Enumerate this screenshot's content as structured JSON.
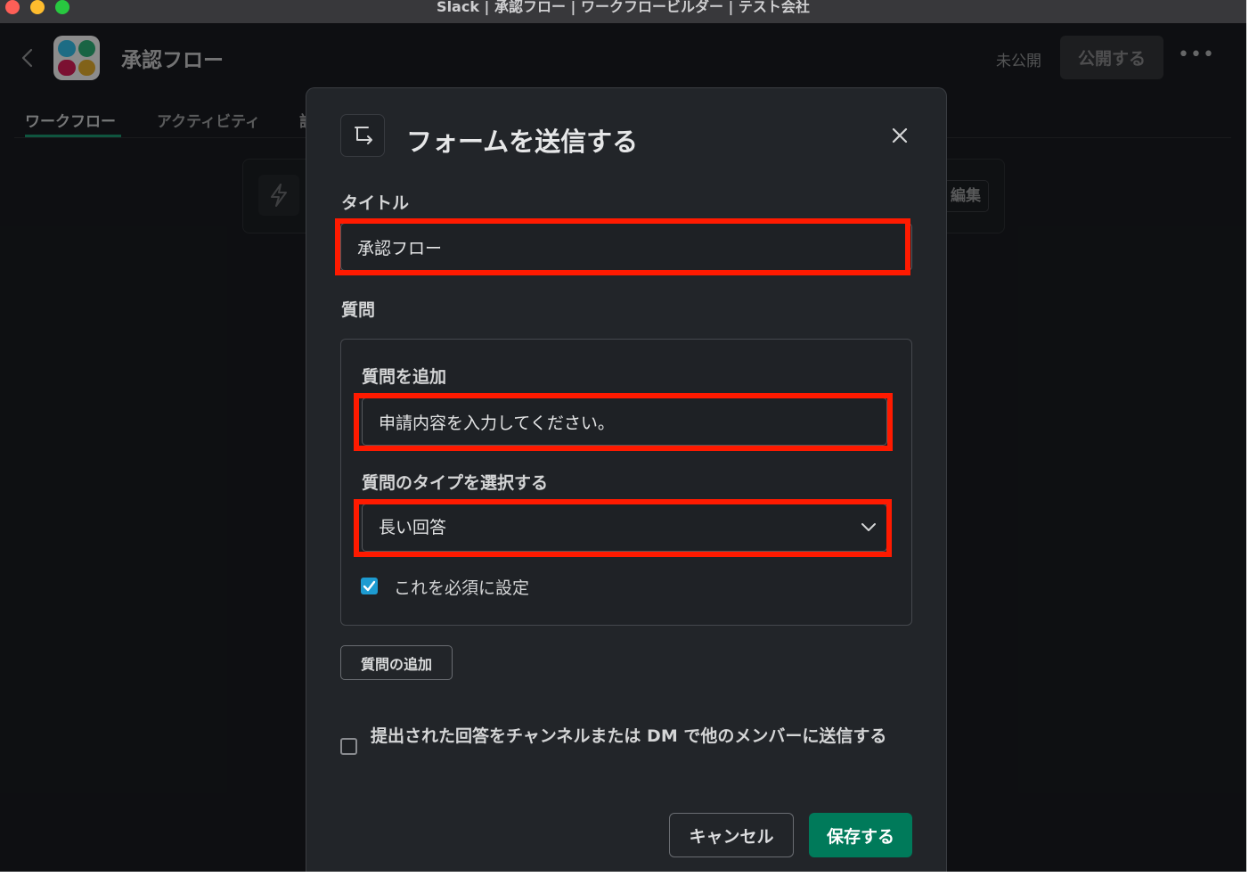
{
  "window": {
    "title": "Slack | 承認フロー | ワークフロービルダー | テスト会社"
  },
  "app": {
    "flow_title": "承認フロー",
    "status": "未公開",
    "publish_label": "公開する",
    "more_label": "•••",
    "logo_colors": [
      "#36c5f0",
      "#2eb67d",
      "#e01e5a",
      "#ecb22e"
    ],
    "tabs": [
      {
        "label": "ワークフロー",
        "active": true
      },
      {
        "label": "アクティビティ",
        "active": false
      },
      {
        "label": "設",
        "active": false
      }
    ],
    "edit_label": "編集",
    "trigger_icon": "lightning-icon"
  },
  "modal": {
    "icon": "form-icon",
    "title": "フォームを送信する",
    "close_icon": "close-icon",
    "title_label": "タイトル",
    "title_value": "承認フロー",
    "questions_label": "質問",
    "question_card": {
      "add_label": "質問を追加",
      "question_value": "申請内容を入力してください。",
      "type_label": "質問のタイプを選択する",
      "type_value": "長い回答",
      "required_label": "これを必須に設定",
      "required_checked": true
    },
    "add_question_button": "質問の追加",
    "send_responses_label": "提出された回答をチャンネルまたは DM で他のメンバーに送信する",
    "send_responses_checked": false,
    "cancel_label": "キャンセル",
    "save_label": "保存する"
  },
  "colors": {
    "accent": "#007a5a",
    "highlight": "#ff1a00",
    "checkbox": "#1d9bd1"
  }
}
